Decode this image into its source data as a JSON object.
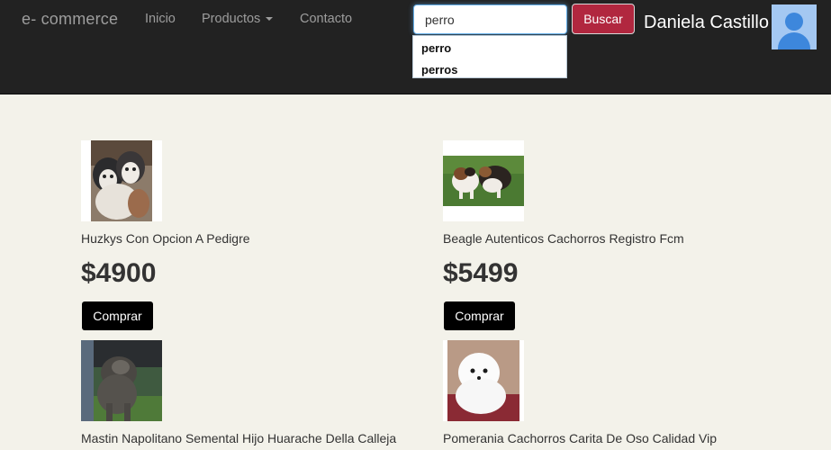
{
  "navbar": {
    "brand": "e- commerce",
    "links": [
      "Inicio",
      "Productos",
      "Contacto"
    ],
    "user_name": "Daniela Castillo"
  },
  "search": {
    "value": "perro",
    "button_label": "Buscar",
    "suggestions": [
      "perro",
      "perros"
    ]
  },
  "products": [
    {
      "title": "Huzkys Con Opcion A Pedigre",
      "price": "$4900",
      "button": "Comprar"
    },
    {
      "title": "Beagle Autenticos Cachorros Registro Fcm",
      "price": "$5499",
      "button": "Comprar"
    },
    {
      "title": "Mastin Napolitano Semental Hijo Huarache Della Calleja",
      "price": "",
      "button": ""
    },
    {
      "title": "Pomerania Cachorros Carita De Oso Calidad Vip",
      "price": "",
      "button": ""
    }
  ],
  "colors": {
    "navbar_bg": "#222222",
    "page_bg": "#f3f2ea",
    "search_button": "#b1273f",
    "buy_button": "#000000"
  },
  "icons": [
    "caret-down-icon",
    "user-avatar-icon"
  ]
}
